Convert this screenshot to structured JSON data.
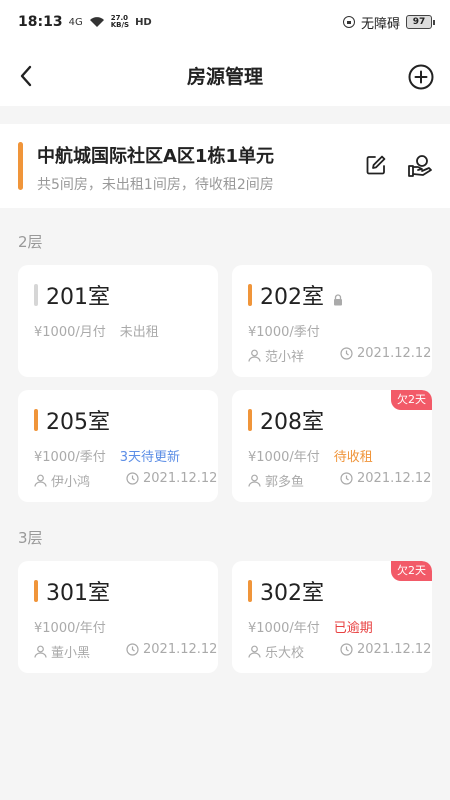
{
  "status_bar": {
    "time": "18:13",
    "signal": "4G",
    "net_speed": "27.0",
    "net_unit": "KB/S",
    "hd": "HD",
    "accessibility": "无障碍",
    "battery": "97"
  },
  "nav": {
    "title": "房源管理",
    "back_icon": "chevron-left-icon",
    "add_icon": "plus-circle-icon"
  },
  "building": {
    "name": "中航城国际社区A区1栋1单元",
    "summary": "共5间房，未出租1间房，待收租2间房",
    "edit_icon": "edit-icon",
    "rent_icon": "hand-money-icon"
  },
  "floors": [
    {
      "label": "2层",
      "rooms": [
        {
          "name": "201室",
          "price": "¥1000/月付",
          "status": "未出租",
          "status_color": "#aaaaaa",
          "tenant": "",
          "date": "",
          "locked": false,
          "badge": ""
        },
        {
          "name": "202室",
          "price": "¥1000/季付",
          "status": "",
          "tenant": "范小祥",
          "date": "2021.12.12",
          "locked": true,
          "badge": ""
        },
        {
          "name": "205室",
          "price": "¥1000/季付",
          "status": "3天待更新",
          "status_color": "#5c8ee6",
          "tenant": "伊小鸿",
          "date": "2021.12.12",
          "locked": false,
          "badge": ""
        },
        {
          "name": "208室",
          "price": "¥1000/年付",
          "status": "待收租",
          "status_color": "#f0953a",
          "tenant": "郭多鱼",
          "date": "2021.12.12",
          "locked": false,
          "badge": "欠2天"
        }
      ]
    },
    {
      "label": "3层",
      "rooms": [
        {
          "name": "301室",
          "price": "¥1000/年付",
          "status": "",
          "tenant": "董小黑",
          "date": "2021.12.12",
          "locked": false,
          "badge": ""
        },
        {
          "name": "302室",
          "price": "¥1000/年付",
          "status": "已逾期",
          "status_color": "#e84040",
          "tenant": "乐大校",
          "date": "2021.12.12",
          "locked": false,
          "badge": "欠2天"
        }
      ]
    }
  ],
  "colors": {
    "accent": "#f0953a",
    "badge": "#f25a68",
    "vacant_accent": "#d6d6d6"
  }
}
